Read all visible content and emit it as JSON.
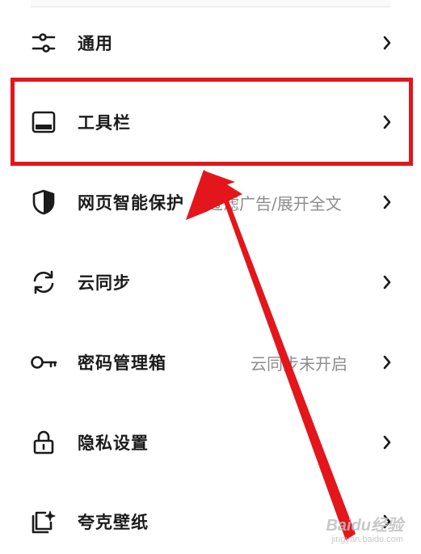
{
  "menu": {
    "items": [
      {
        "label": "通用",
        "sub": "",
        "icon": "sliders-icon"
      },
      {
        "label": "工具栏",
        "sub": "",
        "icon": "toolbar-icon"
      },
      {
        "label": "网页智能保护",
        "sub": "过滤广告/展开全文",
        "icon": "shield-icon"
      },
      {
        "label": "云同步",
        "sub": "",
        "icon": "sync-icon"
      },
      {
        "label": "密码管理箱",
        "sub": "云同步未开启",
        "icon": "key-icon"
      },
      {
        "label": "隐私设置",
        "sub": "",
        "icon": "lock-icon"
      },
      {
        "label": "夸克壁纸",
        "sub": "",
        "icon": "wallpaper-icon"
      }
    ]
  },
  "annotation": {
    "color": "#e3161b",
    "highlighted_item": "工具栏"
  },
  "watermark": {
    "main": "Baidu经验",
    "sub": "jingyan.baidu.com"
  }
}
